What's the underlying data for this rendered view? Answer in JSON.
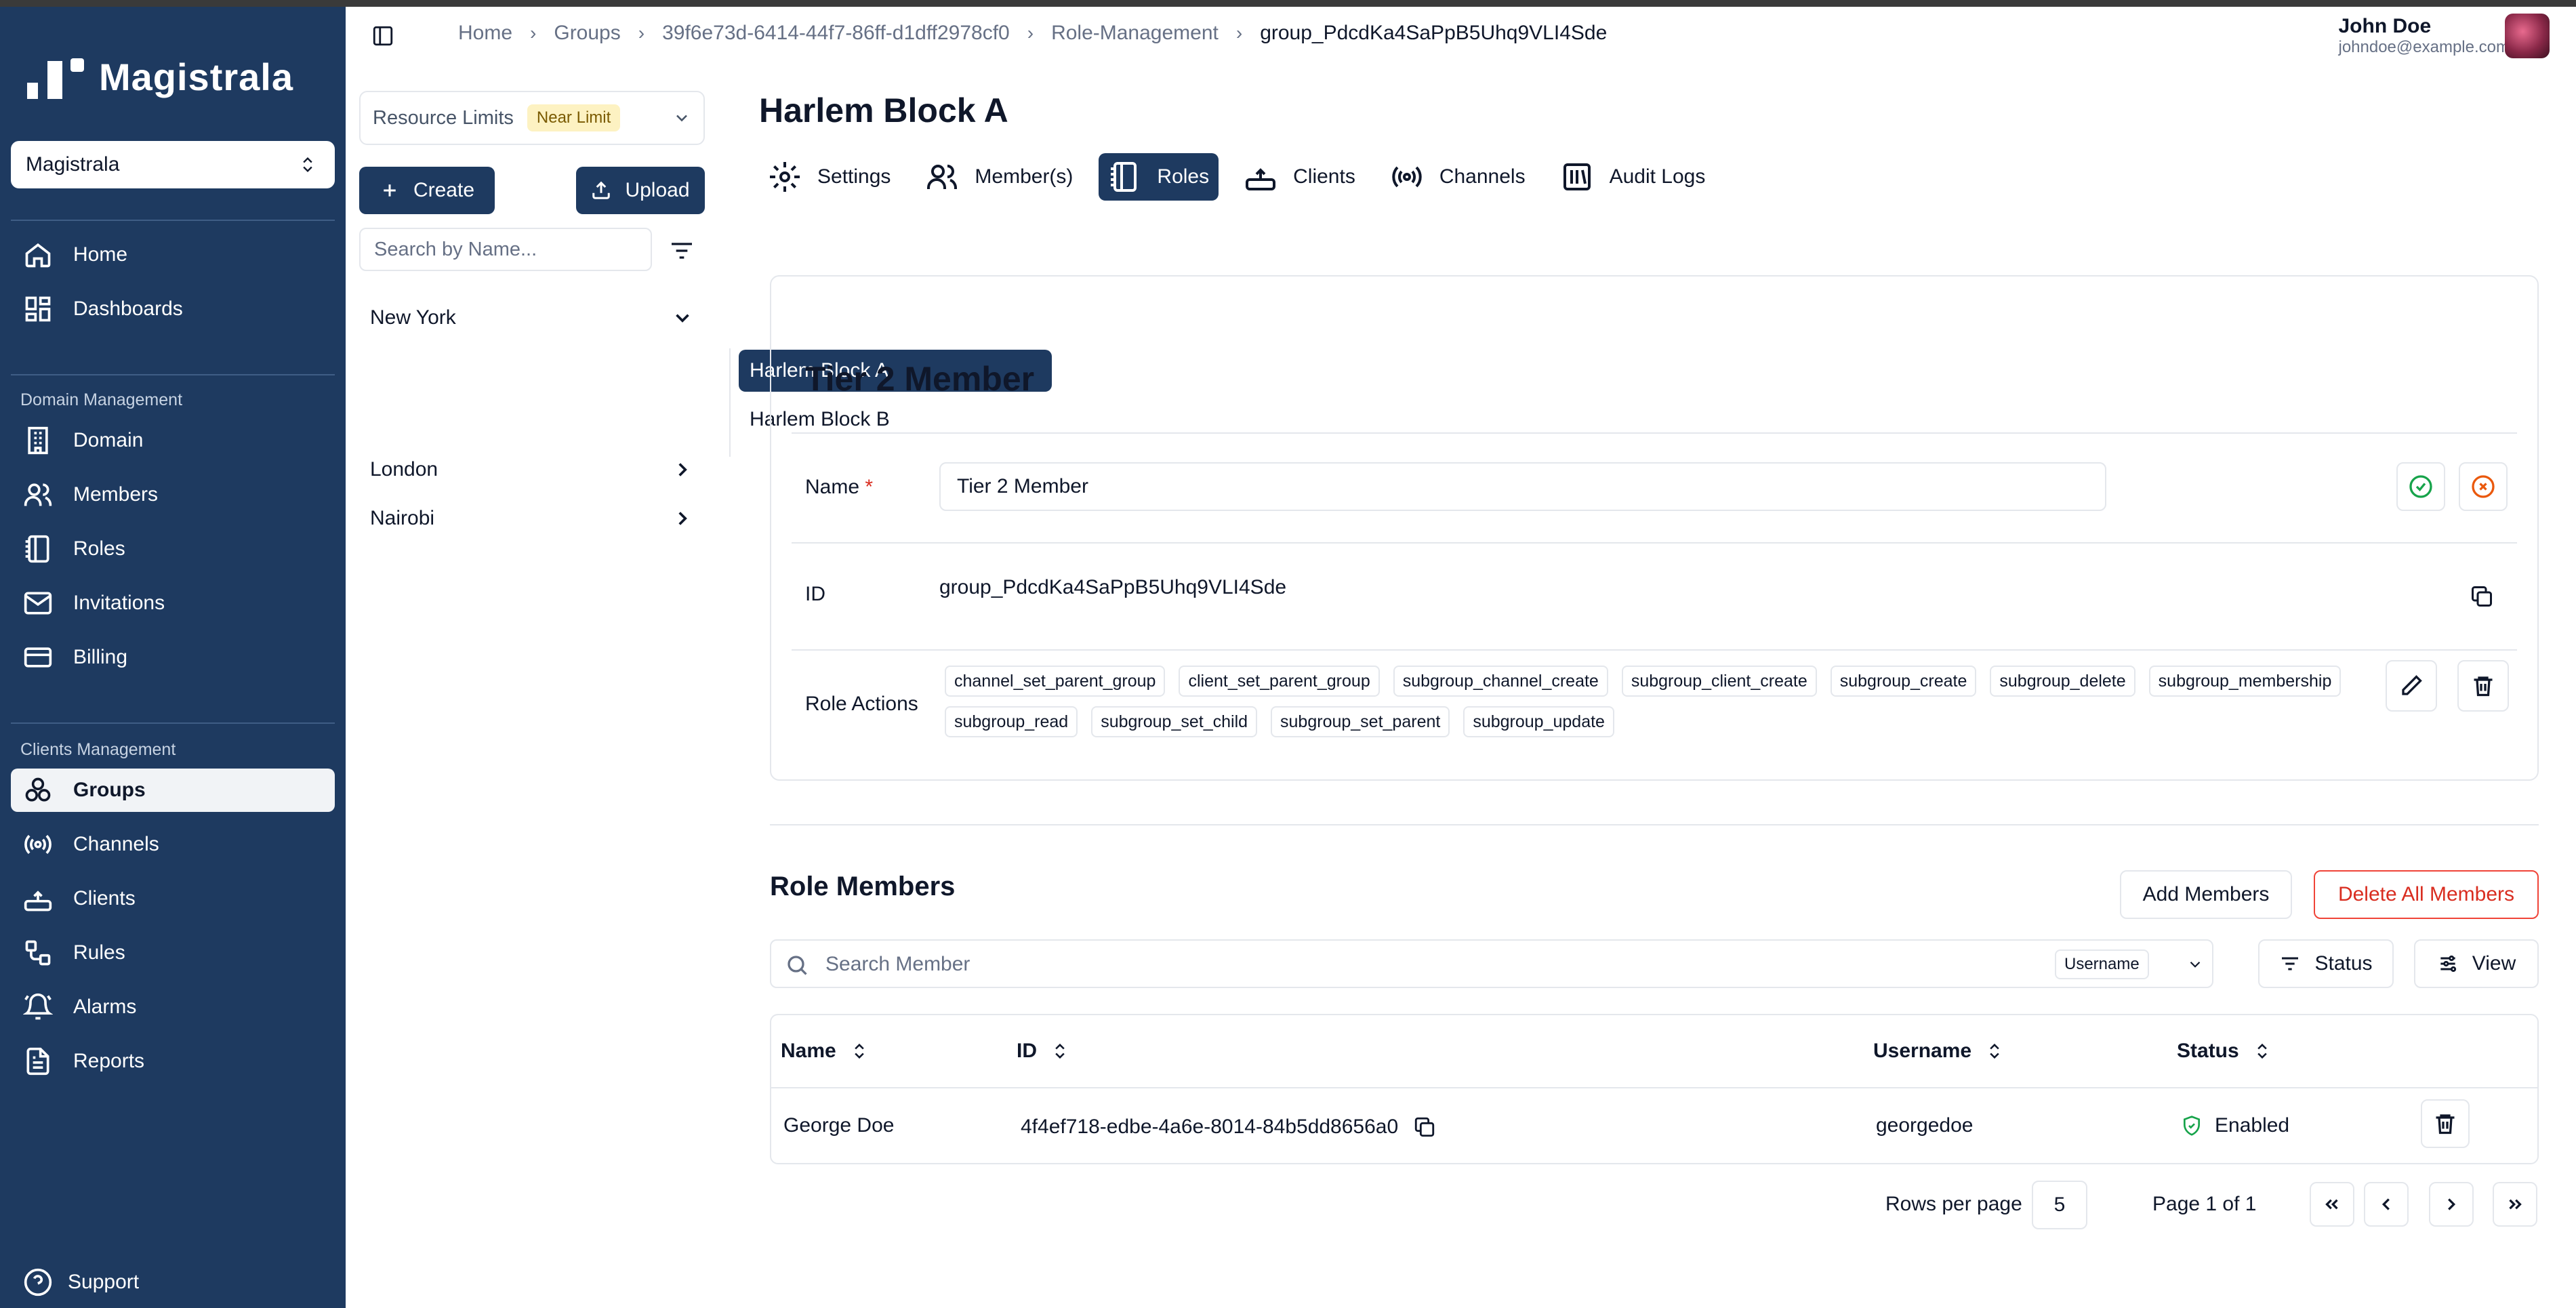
{
  "brand": {
    "name": "Magistrala"
  },
  "sidebar": {
    "domain_select": "Magistrala",
    "items_top": [
      {
        "label": "Home",
        "icon": "home-icon"
      },
      {
        "label": "Dashboards",
        "icon": "dashboard-icon"
      }
    ],
    "section_domain": "Domain Management",
    "items_domain": [
      {
        "label": "Domain",
        "icon": "building-icon"
      },
      {
        "label": "Members",
        "icon": "users-icon"
      },
      {
        "label": "Roles",
        "icon": "notebook-icon"
      },
      {
        "label": "Invitations",
        "icon": "mail-icon"
      },
      {
        "label": "Billing",
        "icon": "card-icon"
      }
    ],
    "section_clients": "Clients Management",
    "items_clients": [
      {
        "label": "Groups",
        "icon": "groups-icon",
        "active": true
      },
      {
        "label": "Channels",
        "icon": "broadcast-icon"
      },
      {
        "label": "Clients",
        "icon": "router-icon"
      },
      {
        "label": "Rules",
        "icon": "rules-icon"
      },
      {
        "label": "Alarms",
        "icon": "bell-icon"
      },
      {
        "label": "Reports",
        "icon": "report-icon"
      }
    ],
    "support": "Support"
  },
  "groups_panel": {
    "resource_limits": "Resource Limits",
    "limit_badge": "Near Limit",
    "create": "Create",
    "upload": "Upload",
    "search_placeholder": "Search by Name...",
    "tree": {
      "new_york": "New York",
      "harlem_a": "Harlem Block A",
      "harlem_b": "Harlem Block B",
      "london": "London",
      "nairobi": "Nairobi"
    }
  },
  "header": {
    "breadcrumb": [
      "Home",
      "Groups",
      "39f6e73d-6414-44f7-86ff-d1dff2978cf0",
      "Role-Management",
      "group_PdcdKa4SaPpB5Uhq9VLI4Sde"
    ],
    "user_name": "John Doe",
    "user_email": "johndoe@example.com"
  },
  "page": {
    "title": "Harlem Block A",
    "tabs": [
      {
        "label": "Settings",
        "icon": "gear-icon"
      },
      {
        "label": "Member(s)",
        "icon": "users-icon"
      },
      {
        "label": "Roles",
        "icon": "notebook-icon",
        "active": true
      },
      {
        "label": "Clients",
        "icon": "router-icon"
      },
      {
        "label": "Channels",
        "icon": "broadcast-icon"
      },
      {
        "label": "Audit Logs",
        "icon": "logs-icon"
      }
    ]
  },
  "role": {
    "title": "Tier 2 Member",
    "name_label": "Name",
    "required_mark": "*",
    "name_value": "Tier 2 Member",
    "id_label": "ID",
    "id_value": "group_PdcdKa4SaPpB5Uhq9VLI4Sde",
    "actions_label": "Role Actions",
    "actions": [
      "channel_set_parent_group",
      "client_set_parent_group",
      "subgroup_channel_create",
      "subgroup_client_create",
      "subgroup_create",
      "subgroup_delete",
      "subgroup_membership",
      "subgroup_read",
      "subgroup_set_child",
      "subgroup_set_parent",
      "subgroup_update"
    ],
    "colors": {
      "confirm": "#16a34a",
      "cancel": "#ea580c",
      "danger": "#d92d20",
      "primary": "#1e3a60"
    }
  },
  "members": {
    "title": "Role Members",
    "add_button": "Add Members",
    "delete_all_button": "Delete All Members",
    "search_placeholder": "Search Member",
    "search_field": "Username",
    "status_filter": "Status",
    "view_button": "View",
    "columns": [
      "Name",
      "ID",
      "Username",
      "Status"
    ],
    "rows": [
      {
        "name": "George Doe",
        "id": "4f4ef718-edbe-4a6e-8014-84b5dd8656a0",
        "username": "georgedoe",
        "status": "Enabled"
      }
    ],
    "rows_per_page_label": "Rows per page",
    "rows_per_page": "5",
    "page_info": "Page 1 of 1"
  }
}
